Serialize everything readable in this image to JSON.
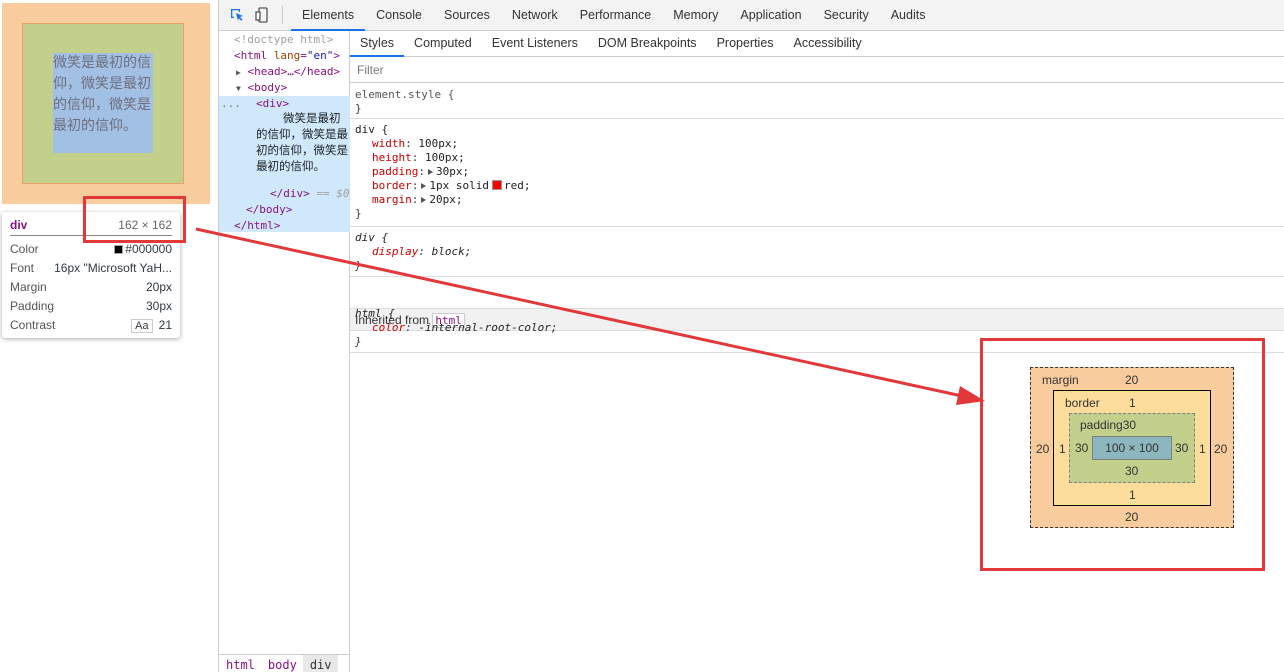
{
  "preview": {
    "text": "微笑是最初的信仰，微笑是最初的信仰，微笑是最初的信仰。"
  },
  "tooltip": {
    "tag": "div",
    "size": "162 × 162",
    "rows": [
      {
        "key": "Color",
        "value": "#000000"
      },
      {
        "key": "Font",
        "value": "16px \"Microsoft YaH..."
      },
      {
        "key": "Margin",
        "value": "20px"
      },
      {
        "key": "Padding",
        "value": "30px"
      },
      {
        "key": "Contrast",
        "badge": "Aa",
        "value": "21"
      }
    ]
  },
  "devtools": {
    "tabs": [
      "Elements",
      "Console",
      "Sources",
      "Network",
      "Performance",
      "Memory",
      "Application",
      "Security",
      "Audits"
    ],
    "active_tab": "Elements",
    "dom": {
      "doctype": "<!doctype html>",
      "html_open_tag": "<html",
      "html_attr_name": "lang",
      "html_attr_value": "\"en\"",
      "html_open_close": ">",
      "head": "<head>…</head>",
      "body_open": "<body>",
      "div_open": "<div>",
      "div_text": "微笑是最初的信仰，微笑是最初的信仰，微笑是最初的信仰。",
      "div_close": "</div>",
      "div_eq": "== $0",
      "body_close": "</body>",
      "html_close": "</html>",
      "dots": "..."
    },
    "breadcrumbs": [
      "html",
      "body",
      "div"
    ],
    "sub_tabs": [
      "Styles",
      "Computed",
      "Event Listeners",
      "DOM Breakpoints",
      "Properties",
      "Accessibility"
    ],
    "active_sub_tab": "Styles",
    "filter_placeholder": "Filter",
    "rules": {
      "element_style": {
        "selector": "element.style {",
        "close": "}"
      },
      "div_rule": {
        "selector": "div {",
        "props": [
          {
            "name": "width",
            "value": "100px;"
          },
          {
            "name": "height",
            "value": "100px;"
          },
          {
            "name": "padding",
            "value": "30px;"
          },
          {
            "name": "border",
            "value": "1px solid",
            "swatch_value": "red;"
          },
          {
            "name": "margin",
            "value": "20px;"
          }
        ],
        "close": "}"
      },
      "ua_rule": {
        "selector": "div {",
        "prop_name": "display",
        "prop_value": "block;",
        "close": "}"
      },
      "inherited_label": "Inherited from",
      "inherited_tag": "html",
      "html_rule": {
        "selector": "html {",
        "prop_name": "color",
        "prop_value": "-internal-root-color;",
        "close": "}"
      }
    },
    "box_model": {
      "margin_label": "margin",
      "margin_top": "20",
      "margin_bottom": "20",
      "margin_left": "20",
      "margin_right": "20",
      "border_label": "border",
      "border_top": "1",
      "border_bottom": "1",
      "border_left": "1",
      "border_right": "1",
      "padding_label": "padding30",
      "padding_bottom": "30",
      "padding_left": "30",
      "padding_right": "30",
      "content": "100 × 100"
    }
  },
  "colors": {
    "annotation": "#e3383a",
    "margin": "#f9cc9d",
    "border": "#fddd9b",
    "padding": "#c3d08b",
    "content": "#8cb6c0",
    "accent": "#1a73e8"
  }
}
